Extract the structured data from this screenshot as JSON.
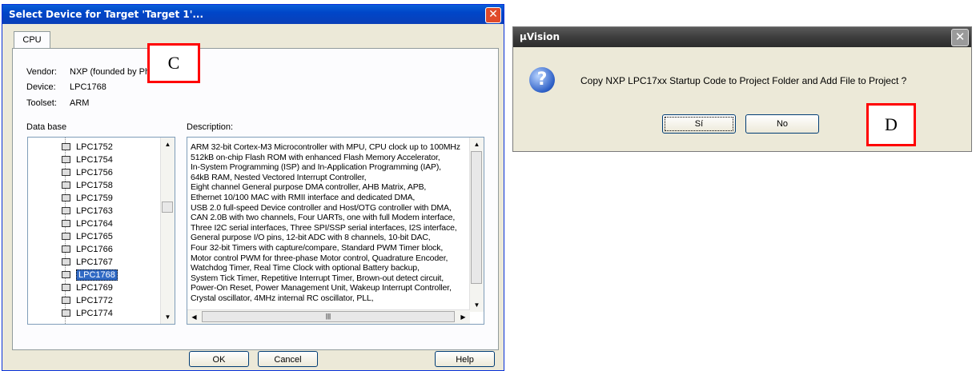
{
  "left_dialog": {
    "title": "Select Device for Target 'Target 1'...",
    "tab": "CPU",
    "vendor_label": "Vendor:",
    "vendor_value": "NXP (founded by Ph",
    "device_label": "Device:",
    "device_value": "LPC1768",
    "toolset_label": "Toolset:",
    "toolset_value": "ARM",
    "database_label": "Data base",
    "description_label": "Description:",
    "devices": [
      "LPC1752",
      "LPC1754",
      "LPC1756",
      "LPC1758",
      "LPC1759",
      "LPC1763",
      "LPC1764",
      "LPC1765",
      "LPC1766",
      "LPC1767",
      "LPC1768",
      "LPC1769",
      "LPC1772",
      "LPC1774"
    ],
    "selected_device": "LPC1768",
    "description_lines": [
      "ARM 32-bit Cortex-M3 Microcontroller with MPU, CPU clock up to 100MHz",
      "512kB on-chip Flash ROM with enhanced Flash Memory Accelerator,",
      "In-System Programming (ISP) and In-Application Programming (IAP),",
      "64kB RAM, Nested Vectored Interrupt Controller,",
      "Eight channel General purpose DMA controller, AHB Matrix, APB,",
      "Ethernet 10/100 MAC with RMII interface and dedicated DMA,",
      "USB 2.0 full-speed Device controller and Host/OTG controller with DMA,",
      "CAN 2.0B with two channels, Four UARTs, one with full Modem interface,",
      "Three I2C serial interfaces, Three SPI/SSP serial interfaces, I2S interface,",
      "General purpose I/O pins, 12-bit ADC with 8 channels, 10-bit DAC,",
      "Four 32-bit Timers with capture/compare, Standard PWM Timer block,",
      "Motor control PWM for three-phase Motor control, Quadrature Encoder,",
      "Watchdog Timer, Real Time Clock with optional Battery backup,",
      "System Tick Timer, Repetitive Interrupt Timer, Brown-out detect circuit,",
      "Power-On Reset, Power Management Unit, Wakeup Interrupt Controller,",
      "Crystal oscillator, 4MHz internal RC oscillator, PLL,"
    ],
    "ok_button": "OK",
    "cancel_button": "Cancel",
    "help_button": "Help",
    "marker": "C"
  },
  "right_dialog": {
    "title": "µVision",
    "message": "Copy NXP LPC17xx Startup Code to Project Folder and Add File to Project ?",
    "yes_button": "Sí",
    "no_button": "No",
    "icon": "question-icon",
    "marker": "D"
  },
  "colors": {
    "xp_blue_title": "#0046c8",
    "dialog_bg": "#ece9d8",
    "selection": "#316ac5",
    "marker_border": "#ff0000"
  }
}
